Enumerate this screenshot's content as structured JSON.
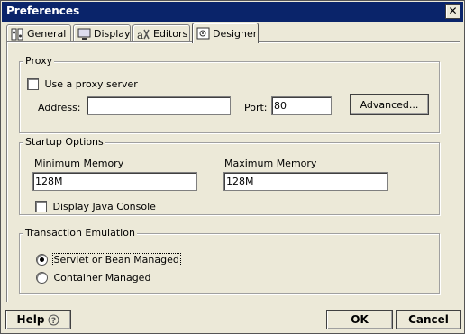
{
  "window": {
    "title": "Preferences",
    "close_glyph": "✕"
  },
  "tabs": [
    {
      "label": "General",
      "icon": "general-icon",
      "active": false
    },
    {
      "label": "Display",
      "icon": "display-icon",
      "active": false
    },
    {
      "label": "Editors",
      "icon": "editors-icon",
      "active": false
    },
    {
      "label": "Designer",
      "icon": "designer-icon",
      "active": true
    }
  ],
  "proxy": {
    "legend": "Proxy",
    "use_proxy_label": "Use a proxy server",
    "use_proxy_checked": false,
    "address_label": "Address:",
    "address_value": "",
    "port_label": "Port:",
    "port_value": "80",
    "advanced_button": "Advanced..."
  },
  "startup": {
    "legend": "Startup Options",
    "min_memory_label": "Minimum Memory",
    "min_memory_value": "128M",
    "max_memory_label": "Maximum Memory",
    "max_memory_value": "128M",
    "java_console_label": "Display Java Console",
    "java_console_checked": false
  },
  "transaction": {
    "legend": "Transaction Emulation",
    "options": [
      {
        "label": "Servlet or Bean Managed",
        "selected": true
      },
      {
        "label": "Container Managed",
        "selected": false
      }
    ]
  },
  "footer": {
    "help_button": "Help",
    "help_icon": "question-circle-icon",
    "ok_button": "OK",
    "cancel_button": "Cancel"
  },
  "colors": {
    "titlebar": "#0a246a",
    "dialog_bg": "#ece9d8"
  }
}
